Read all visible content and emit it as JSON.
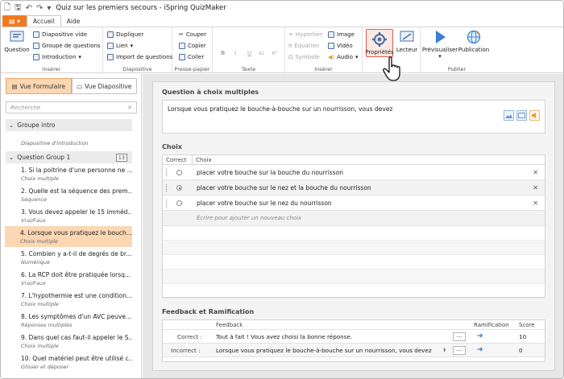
{
  "window": {
    "title": "Quiz sur les premiers secours - iSpring QuizMaker"
  },
  "tabs": [
    {
      "label": "Accueil"
    },
    {
      "label": "Aide"
    }
  ],
  "ribbon": {
    "inserer": {
      "label": "Insérer",
      "question": "Question",
      "diapo_vide": "Diapositive vide",
      "groupe": "Groupe de questions",
      "intro": "Introduction"
    },
    "diapositive": {
      "label": "Diapositive",
      "dupliquer": "Dupliquer",
      "lien": "Lien",
      "importer": "Import de questions"
    },
    "presse": {
      "label": "Presse-papier",
      "couper": "Couper",
      "copier": "Copier",
      "coller": "Coller"
    },
    "texte": {
      "label": "Texte",
      "bold": "B",
      "italic": "I",
      "underline": "U",
      "sub": "x₂",
      "sup": "x²"
    },
    "inserer2": {
      "label": "Insérer",
      "hyperlien": "Hyperlien",
      "equation": "Équation",
      "symbole": "Symbole",
      "image": "Image",
      "video": "Vidéo",
      "audio": "Audio"
    },
    "proprietes": "Propriétés",
    "lecteur": "Lecteur",
    "publier": {
      "label": "Publier",
      "previsualiser": "Prévisualiser",
      "publication": "Publication"
    }
  },
  "sidebar": {
    "view_form": "Vue Formulaire",
    "view_slide": "Vue Diapositive",
    "search_placeholder": "Recherche",
    "groups": [
      {
        "name": "Groupe intro",
        "items": [
          {
            "title": "Diapositive d'introduction"
          }
        ]
      },
      {
        "name": "Question Group 1",
        "count": "13",
        "items": [
          {
            "title": "1. Si la poitrine d'une personne ne ...",
            "type": "Choix multiple"
          },
          {
            "title": "2. Quelle est la séquence des prem...",
            "type": "Séquence"
          },
          {
            "title": "3. Vous devez appeler le 15 imméd...",
            "type": "Vrai/Faux"
          },
          {
            "title": "4. Lorsque vous pratiquez le bouch...",
            "type": "Choix multiple"
          },
          {
            "title": "5. Combien y a-t-il de degrés de br...",
            "type": "Numérique"
          },
          {
            "title": "6. La RCP doit être pratiquée lorsq...",
            "type": "Vrai/Faux"
          },
          {
            "title": "7. L'hypothermie est une condition...",
            "type": "Choix multiple"
          },
          {
            "title": "8. Les symptômes d'un AVC peuve...",
            "type": "Réponses multiples"
          },
          {
            "title": "9. Dans quel cas faut-il appeler le S...",
            "type": "Choix multiple"
          },
          {
            "title": "10. Quel matériel peut être utilisé c...",
            "type": "Glisser et déposer"
          }
        ]
      }
    ]
  },
  "editor": {
    "question_header": "Question à choix multiples",
    "question_text": "Lorsque vous pratiquez le bouche-à-bouche sur un nourrisson, vous devez",
    "choices_header": "Choix",
    "col_correct": "Correct",
    "col_choice": "Choix",
    "choices": [
      {
        "text": "placer votre bouche sur la bouche du nourrisson",
        "correct": false
      },
      {
        "text": "placer votre bouche sur le nez et la bouche du nourrisson",
        "correct": true
      },
      {
        "text": "placer votre bouche sur le nez du nourrisson",
        "correct": false
      }
    ],
    "add_choice": "Écrire pour ajouter un nouveau choix",
    "feedback_header": "Feedback et Ramification",
    "fb_col_feedback": "Feedback",
    "fb_col_branch": "Ramification",
    "fb_col_score": "Score",
    "feedback": [
      {
        "label": "Correct :",
        "text": "Tout à fait ! Vous avez choisi la bonne réponse.",
        "score": "10"
      },
      {
        "label": "Incorrect :",
        "text": "Lorsque vous pratiquez le bouche-à-bouche sur un nourrisson, vous devez",
        "score": "0"
      }
    ]
  },
  "colors": {
    "accent": "#f07a1e",
    "selection": "#fbd7b4",
    "highlight": "#e25b4d"
  }
}
